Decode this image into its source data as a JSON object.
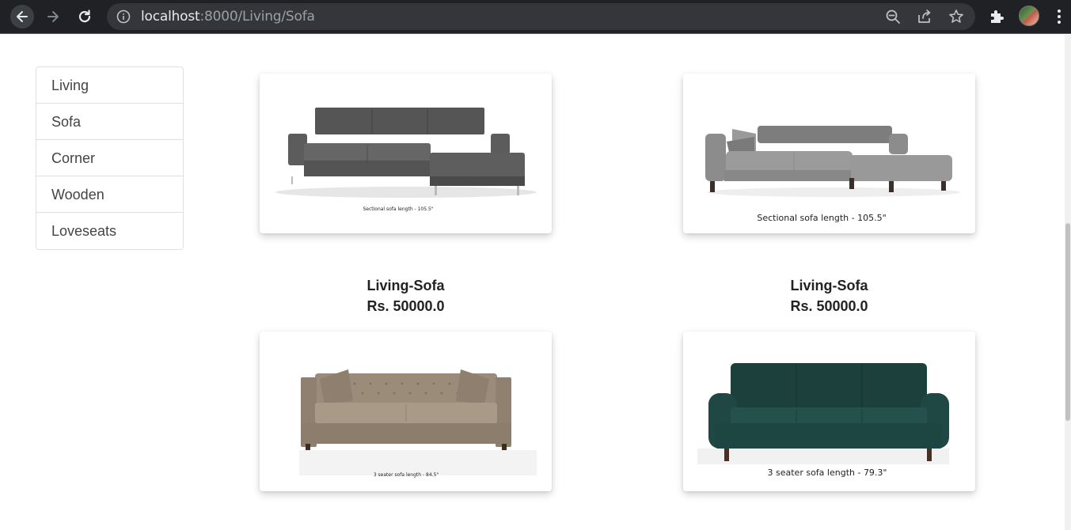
{
  "browser": {
    "url_host": "localhost",
    "url_path": ":8000/Living/Sofa"
  },
  "sidebar": {
    "items": [
      {
        "label": "Living"
      },
      {
        "label": "Sofa"
      },
      {
        "label": "Corner"
      },
      {
        "label": "Wooden"
      },
      {
        "label": "Loveseats"
      }
    ]
  },
  "products": [
    {
      "name": "Living-Sofa",
      "price": "Rs. 50000.0",
      "caption": "Sectional sofa length - 105.5\"",
      "color": "#5b5b5b"
    },
    {
      "name": "Living-Sofa",
      "price": "Rs. 50000.0",
      "caption": "Sectional sofa length - 105.5\"",
      "color": "#8a8a8a"
    },
    {
      "caption": "3 seater sofa length - 84.5\"",
      "color": "#a69684"
    },
    {
      "caption": "3 seater sofa length - 79.3\"",
      "color": "#1f4a45"
    }
  ]
}
